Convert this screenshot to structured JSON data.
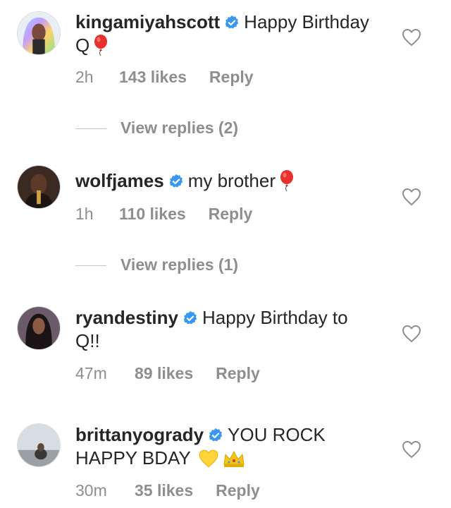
{
  "comments": [
    {
      "username": "kingamiyahscott",
      "text": "Happy Birthday Q",
      "time": "2h",
      "likes": "143 likes",
      "reply": "Reply",
      "view_replies": "View replies (2)",
      "emojis": [
        "balloon-icon"
      ]
    },
    {
      "username": "wolfjames",
      "text": "my brother",
      "time": "1h",
      "likes": "110 likes",
      "reply": "Reply",
      "view_replies": "View replies (1)",
      "emojis": [
        "balloon-icon"
      ]
    },
    {
      "username": "ryandestiny",
      "text": "Happy Birthday to Q!!",
      "time": "47m",
      "likes": "89 likes",
      "reply": "Reply",
      "emojis": []
    },
    {
      "username": "brittanyogrady",
      "text": "YOU ROCK HAPPY BDAY",
      "time": "30m",
      "likes": "35 likes",
      "reply": "Reply",
      "emojis": [
        "yellow-heart-icon",
        "crown-icon"
      ]
    }
  ],
  "colors": {
    "text": "#262626",
    "muted": "#8e8e8e",
    "verified": "#3897f0",
    "balloon": "#e8312f"
  }
}
